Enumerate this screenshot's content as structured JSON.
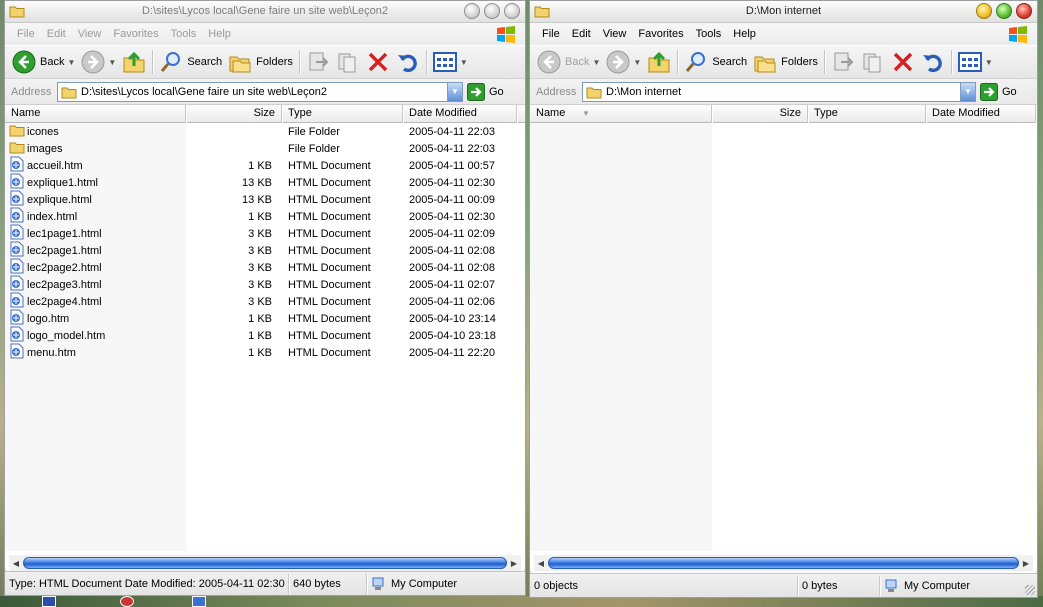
{
  "windows": [
    {
      "title": "D:\\sites\\Lycos local\\Gene faire un site web\\Leçon2",
      "state": "inactive",
      "menu": [
        "File",
        "Edit",
        "View",
        "Favorites",
        "Tools",
        "Help"
      ],
      "toolbar": {
        "back": "Back",
        "search": "Search",
        "folders": "Folders"
      },
      "address": {
        "label": "Address",
        "value": "D:\\sites\\Lycos local\\Gene faire un site web\\Leçon2",
        "go": "Go"
      },
      "columns": {
        "name": "Name",
        "size": "Size",
        "type": "Type",
        "date": "Date Modified"
      },
      "files": [
        {
          "name": "icones",
          "size": "",
          "type": "File Folder",
          "date": "2005-04-11 22:03",
          "icon": "folder-icon"
        },
        {
          "name": "images",
          "size": "",
          "type": "File Folder",
          "date": "2005-04-11 22:03",
          "icon": "folder-icon"
        },
        {
          "name": "accueil.htm",
          "size": "1 KB",
          "type": "HTML Document",
          "date": "2005-04-11 00:57",
          "icon": "html-document-icon"
        },
        {
          "name": "explique1.html",
          "size": "13 KB",
          "type": "HTML Document",
          "date": "2005-04-11 02:30",
          "icon": "html-document-icon"
        },
        {
          "name": "explique.html",
          "size": "13 KB",
          "type": "HTML Document",
          "date": "2005-04-11 00:09",
          "icon": "html-document-icon"
        },
        {
          "name": "index.html",
          "size": "1 KB",
          "type": "HTML Document",
          "date": "2005-04-11 02:30",
          "icon": "html-document-icon"
        },
        {
          "name": "lec1page1.html",
          "size": "3 KB",
          "type": "HTML Document",
          "date": "2005-04-11 02:09",
          "icon": "html-document-icon"
        },
        {
          "name": "lec2page1.html",
          "size": "3 KB",
          "type": "HTML Document",
          "date": "2005-04-11 02:08",
          "icon": "html-document-icon"
        },
        {
          "name": "lec2page2.html",
          "size": "3 KB",
          "type": "HTML Document",
          "date": "2005-04-11 02:08",
          "icon": "html-document-icon"
        },
        {
          "name": "lec2page3.html",
          "size": "3 KB",
          "type": "HTML Document",
          "date": "2005-04-11 02:07",
          "icon": "html-document-icon"
        },
        {
          "name": "lec2page4.html",
          "size": "3 KB",
          "type": "HTML Document",
          "date": "2005-04-11 02:06",
          "icon": "html-document-icon"
        },
        {
          "name": "logo.htm",
          "size": "1 KB",
          "type": "HTML Document",
          "date": "2005-04-10 23:14",
          "icon": "html-document-icon"
        },
        {
          "name": "logo_model.htm",
          "size": "1 KB",
          "type": "HTML Document",
          "date": "2005-04-10 23:18",
          "icon": "html-document-icon"
        },
        {
          "name": "menu.htm",
          "size": "1 KB",
          "type": "HTML Document",
          "date": "2005-04-11 22:20",
          "icon": "html-document-icon"
        }
      ],
      "status": {
        "info": "Type: HTML Document Date Modified: 2005-04-11 02:30 S",
        "size": "640 bytes",
        "zone": "My Computer"
      }
    },
    {
      "title": "D:\\Mon internet",
      "state": "active",
      "menu": [
        "File",
        "Edit",
        "View",
        "Favorites",
        "Tools",
        "Help"
      ],
      "toolbar": {
        "back": "Back",
        "search": "Search",
        "folders": "Folders"
      },
      "address": {
        "label": "Address",
        "value": "D:\\Mon internet",
        "go": "Go"
      },
      "columns": {
        "name": "Name",
        "size": "Size",
        "type": "Type",
        "date": "Date Modified"
      },
      "files": [],
      "status": {
        "info": "0 objects",
        "size": "0 bytes",
        "zone": "My Computer"
      }
    }
  ],
  "colors": {
    "accent": "#1d5ccc",
    "go_green": "#2e9e2e",
    "delete_red": "#d42020",
    "folder_yellow": "#f3d36b"
  }
}
